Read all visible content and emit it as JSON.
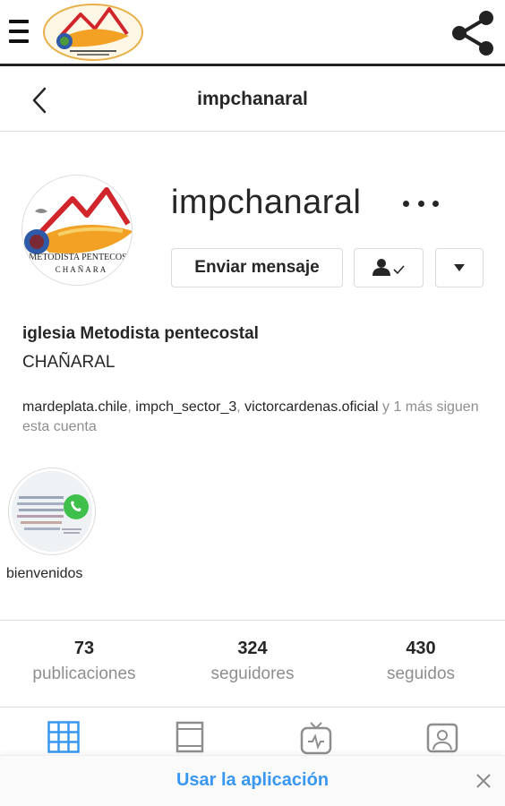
{
  "app_bar": {
    "menu_icon": "hamburger-menu-icon",
    "logo_icon": "church-logo",
    "share_icon": "share-icon"
  },
  "header": {
    "back_icon": "chevron-left-icon",
    "title": "impchanaral"
  },
  "profile": {
    "username": "impchanaral",
    "more_icon": "more-options-icon",
    "avatar_icon": "church-logo-avatar",
    "message_button": "Enviar mensaje",
    "follow_icon": "following-check-icon",
    "dropdown_icon": "dropdown-triangle-icon",
    "bio_name": "iglesia Metodista pentecostal",
    "bio_text": "CHAÑARAL",
    "followed_by": {
      "users": [
        "mardeplata.chile",
        "impch_sector_3",
        "victorcardenas.oficial"
      ],
      "sep1": ", ",
      "sep2": ", ",
      "suffix": " y 1 más siguen esta cuenta"
    },
    "avatar_text": {
      "line1": "METODISTA PENTECOS",
      "line2": "CHAÑARA"
    }
  },
  "highlight": {
    "label": "bienvenidos",
    "icon": "whatsapp-icon"
  },
  "stats": [
    {
      "value": "73",
      "label": "publicaciones"
    },
    {
      "value": "324",
      "label": "seguidores"
    },
    {
      "value": "430",
      "label": "seguidos"
    }
  ],
  "tabs": [
    {
      "icon": "grid-icon",
      "active": true
    },
    {
      "icon": "feed-icon",
      "active": false
    },
    {
      "icon": "igtv-icon",
      "active": false
    },
    {
      "icon": "tagged-icon",
      "active": false
    }
  ],
  "banner": {
    "link": "Usar la aplicación",
    "close_icon": "close-icon"
  },
  "colors": {
    "accent_blue": "#3897f0",
    "text_dark": "#262626",
    "text_gray": "#8e8e8e",
    "border": "#dbdbdb",
    "logo_red": "#d0262b",
    "logo_orange": "#f2a125"
  }
}
